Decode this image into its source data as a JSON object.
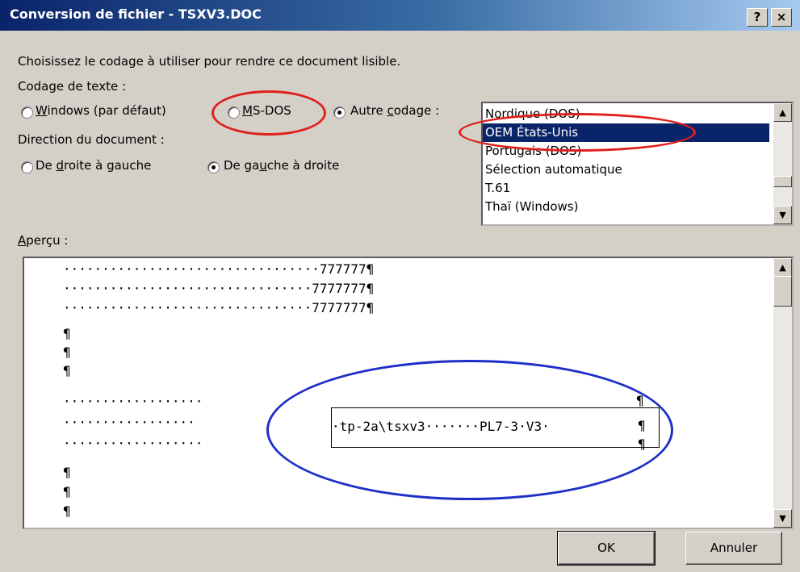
{
  "window": {
    "title": "Conversion de fichier - TSXV3.DOC",
    "help_button": "?",
    "close_button": "×"
  },
  "instruction": "Choisissez le codage à utiliser pour rendre ce document lisible.",
  "encoding": {
    "label": "Codage de texte :",
    "windows_pre": "",
    "windows_u": "W",
    "windows_post": "indows (par défaut)",
    "msdos_pre": "",
    "msdos_u": "M",
    "msdos_post": "S-DOS",
    "other_pre": "Autre ",
    "other_u": "c",
    "other_post": "odage :",
    "selected": "other"
  },
  "direction": {
    "label": "Direction du document :",
    "rtl_pre": "De ",
    "rtl_u": "d",
    "rtl_post": "roite à gauche",
    "ltr_pre": "De ga",
    "ltr_u": "u",
    "ltr_post": "che à droite",
    "selected": "ltr"
  },
  "encoding_list": {
    "items": [
      "Nordique (DOS)",
      "OEM États-Unis",
      "Portugais (DOS)",
      "Sélection automatique",
      "T.61",
      "Thaï (Windows)"
    ],
    "selected_index": 1
  },
  "preview": {
    "label_u": "A",
    "label_post": "perçu :",
    "lines": [
      "·································777777¶",
      "································7777777¶",
      "································7777777¶",
      "¶",
      "¶",
      "¶",
      "··················",
      "·················",
      "··················",
      "¶",
      "¶",
      "¶"
    ],
    "frame_text": "·tp-2a\\tsxv3·······PL7-3·V3·",
    "frame_marks": [
      "¶",
      "¶",
      "¶"
    ]
  },
  "buttons": {
    "ok": "OK",
    "cancel": "Annuler"
  },
  "colors": {
    "title_start": "#0a246a",
    "selection": "#0a246a",
    "red_annotation": "#e0201c",
    "blue_annotation": "#1e2fc8"
  }
}
